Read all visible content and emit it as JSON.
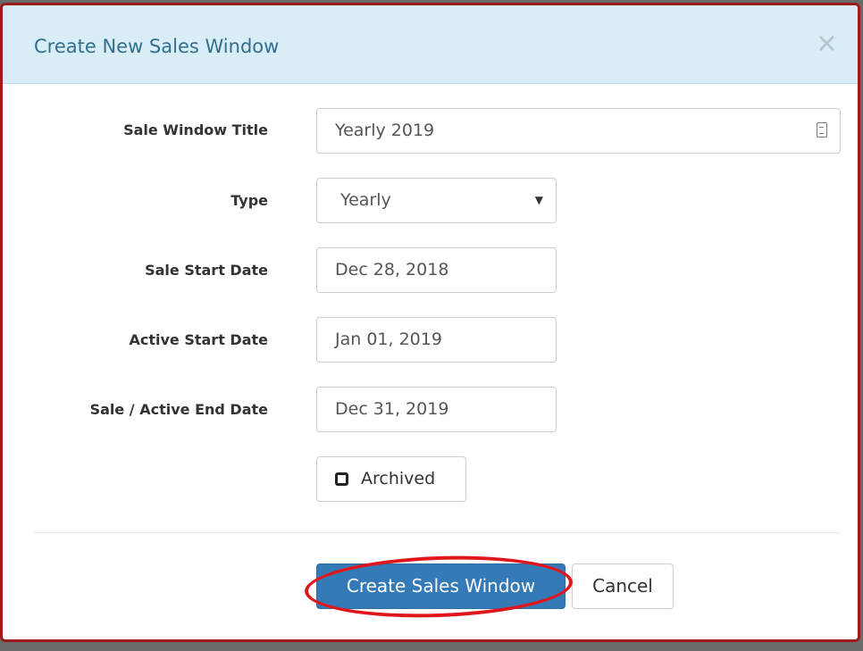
{
  "modal": {
    "title": "Create New Sales Window",
    "close_glyph": "×"
  },
  "form": {
    "title_label": "Sale Window Title",
    "title_value": "Yearly 2019",
    "type_label": "Type",
    "type_value": "Yearly",
    "sale_start_label": "Sale Start Date",
    "sale_start_value": "Dec 28, 2018",
    "active_start_label": "Active Start Date",
    "active_start_value": "Jan 01, 2019",
    "end_label": "Sale / Active End Date",
    "end_value": "Dec 31, 2019",
    "archived_label": "Archived",
    "archived_checked": false
  },
  "footer": {
    "create_label": "Create Sales Window",
    "cancel_label": "Cancel"
  },
  "colors": {
    "header_bg": "#d9edf7",
    "title_color": "#31708f",
    "primary": "#337ab7",
    "highlight_ring": "#e0161d",
    "modal_border": "#9b1c1c"
  },
  "icons": [
    "close-icon",
    "text-field-icon",
    "chevron-down-icon",
    "checkbox-icon"
  ]
}
